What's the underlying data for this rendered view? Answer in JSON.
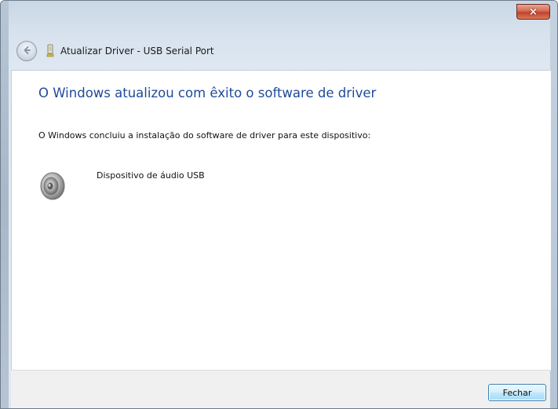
{
  "window": {
    "title": "Atualizar Driver - USB Serial Port",
    "close_icon": "×"
  },
  "icons": {
    "back": "back-arrow-icon",
    "device_small": "usb-device-icon",
    "device": "speaker-icon"
  },
  "content": {
    "heading": "O Windows atualizou com êxito o software de driver",
    "description": "O Windows concluiu a instalação do software de driver para este dispositivo:",
    "device_name": "Dispositivo de áudio USB"
  },
  "footer": {
    "close_label": "Fechar"
  },
  "colors": {
    "heading": "#1f4a9b",
    "close_button": "#c2412a",
    "primary_button_border": "#3c7fb1"
  }
}
